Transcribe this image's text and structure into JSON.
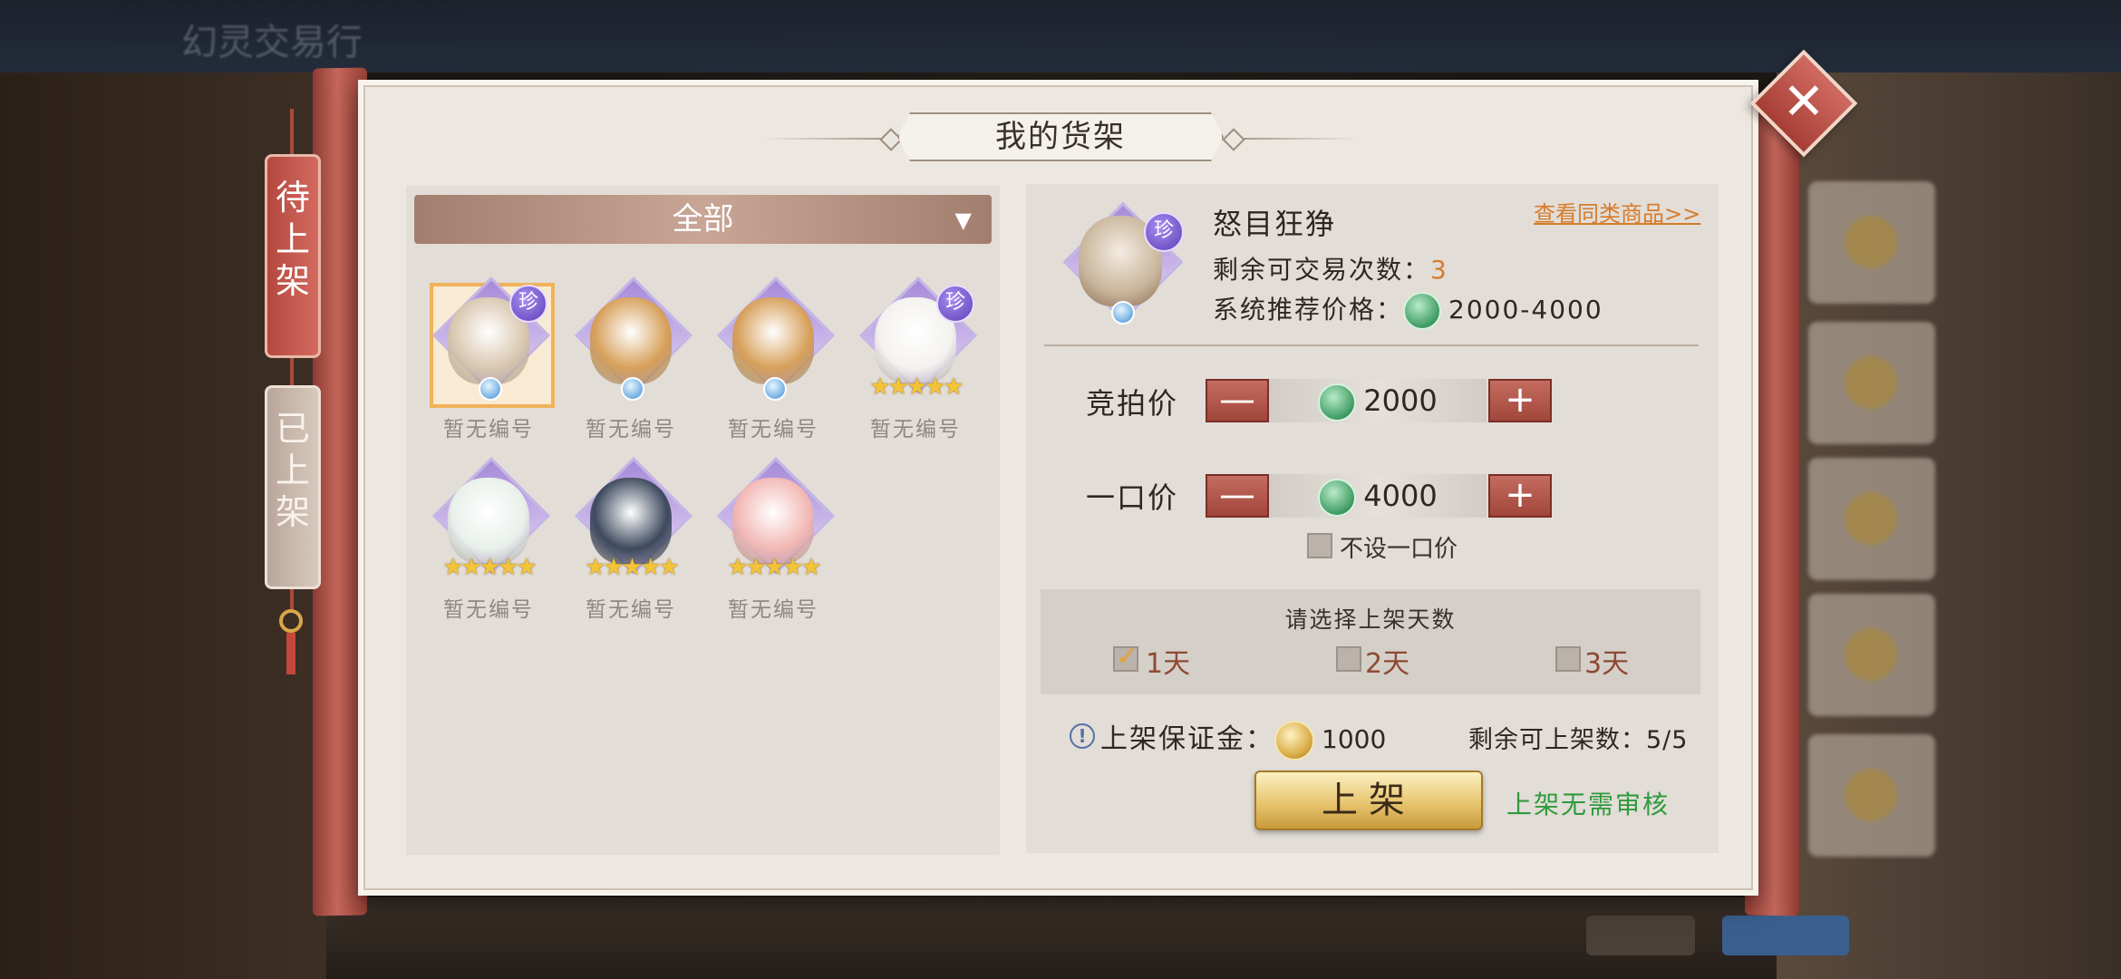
{
  "background": {
    "top_bar_title": "幻灵交易行"
  },
  "panel": {
    "title": "我的货架",
    "close_label": "✕"
  },
  "tabs": [
    {
      "label": "待上架",
      "active": true
    },
    {
      "label": "已上架",
      "active": false
    }
  ],
  "filter": {
    "selected": "全部",
    "arrow": "▼"
  },
  "items": [
    {
      "label": "暂无编号",
      "rare_badge": "珍",
      "stars": "",
      "selected": true,
      "color": "#d9c7b0"
    },
    {
      "label": "暂无编号",
      "rare_badge": "",
      "stars": "",
      "selected": false,
      "color": "#d7a05a"
    },
    {
      "label": "暂无编号",
      "rare_badge": "",
      "stars": "",
      "selected": false,
      "color": "#d7a05a"
    },
    {
      "label": "暂无编号",
      "rare_badge": "珍",
      "stars": "★★★★★",
      "selected": false,
      "color": "#f4f2ef"
    },
    {
      "label": "暂无编号",
      "rare_badge": "",
      "stars": "★★★★★",
      "selected": false,
      "color": "#e9f0ea"
    },
    {
      "label": "暂无编号",
      "rare_badge": "",
      "stars": "★★★★★",
      "selected": false,
      "color": "#3e4a5e"
    },
    {
      "label": "暂无编号",
      "rare_badge": "",
      "stars": "★★★★★",
      "selected": false,
      "color": "#f2b8b4"
    }
  ],
  "detail": {
    "name": "怒目狂狰",
    "rare_badge": "珍",
    "similar_link": "查看同类商品>>",
    "remaining_trades_label": "剩余可交易次数：",
    "remaining_trades_value": "3",
    "recommended_label": "系统推荐价格：",
    "recommended_value": "2000-4000"
  },
  "auction": {
    "label": "竞拍价",
    "value": "2000",
    "minus": "—",
    "plus": "+"
  },
  "buyout": {
    "label": "一口价",
    "value": "4000",
    "minus": "—",
    "plus": "+",
    "no_buyout_label": "不设一口价",
    "no_buyout_checked": false
  },
  "days": {
    "title": "请选择上架天数",
    "options": [
      {
        "label": "1天",
        "checked": true
      },
      {
        "label": "2天",
        "checked": false
      },
      {
        "label": "3天",
        "checked": false
      }
    ]
  },
  "deposit": {
    "info_icon": "!",
    "label": "上架保证金：",
    "value": "1000"
  },
  "remaining_listings": {
    "label": "剩余可上架数：",
    "value": "5/5"
  },
  "list_button": "上架",
  "no_review_text": "上架无需审核"
}
